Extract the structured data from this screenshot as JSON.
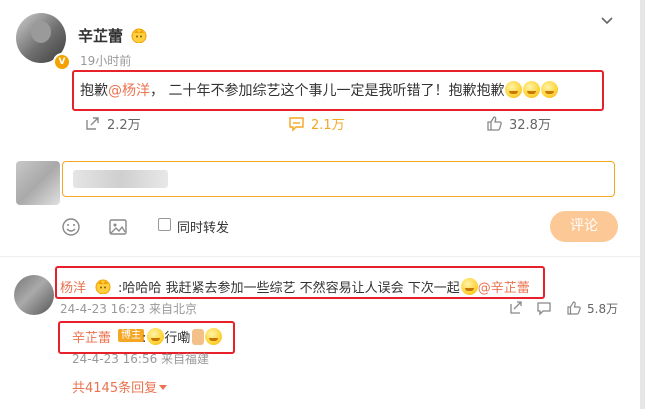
{
  "post": {
    "author": "辛芷蕾",
    "time": "19小时前",
    "text_before": "抱歉",
    "mention": "@杨洋",
    "text_after": "， 二十年不参加综艺这个事儿一定是我听错了！抱歉抱歉",
    "actions": {
      "repost": "2.2万",
      "comment": "2.1万",
      "like": "32.8万"
    }
  },
  "composer": {
    "also_repost_label": "同时转发",
    "submit_label": "评论"
  },
  "comment": {
    "author": "杨洋",
    "text": ":哈哈哈 我赶紧去参加一些综艺 不然容易让人误会 下次一起",
    "mention": "@辛芷蕾",
    "time": "24-4-23 16:23 来自北京",
    "like_count": "5.8万"
  },
  "reply": {
    "author": "辛芷蕾",
    "badge": "博主",
    "text": ":",
    "text2": "行嘞",
    "time": "24-4-23 16:56 来自福建"
  },
  "more_replies": "共4145条回复",
  "colors": {
    "accent": "#eb7350",
    "highlight": "#f5a623",
    "annotation": "#e8202a"
  }
}
